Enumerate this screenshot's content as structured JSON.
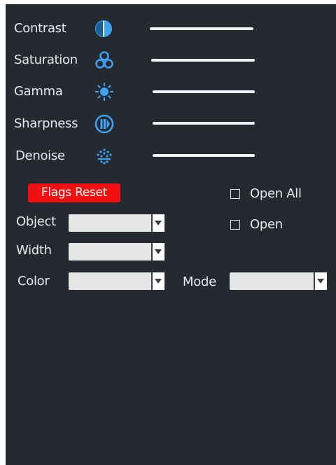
{
  "adjustments": [
    {
      "label": "Contrast",
      "icon": "contrast-icon"
    },
    {
      "label": "Saturation",
      "icon": "saturation-icon"
    },
    {
      "label": "Gamma",
      "icon": "gamma-sun-icon"
    },
    {
      "label": "Sharpness",
      "icon": "sharpness-icon"
    },
    {
      "label": "Denoise",
      "icon": "denoise-icon"
    }
  ],
  "flags_reset_label": "Flags Reset",
  "open_all_label": "Open All",
  "open_label": "Open",
  "object_label": "Object",
  "width_label": "Width",
  "color_label": "Color",
  "mode_label": "Mode",
  "object_value": "",
  "width_value": "",
  "color_value": "",
  "mode_value": "",
  "colors": {
    "panel_bg": "#252a31",
    "accent_icon": "#3ea3f5",
    "reset_button": "#f01010",
    "text": "#e8e8e8"
  }
}
